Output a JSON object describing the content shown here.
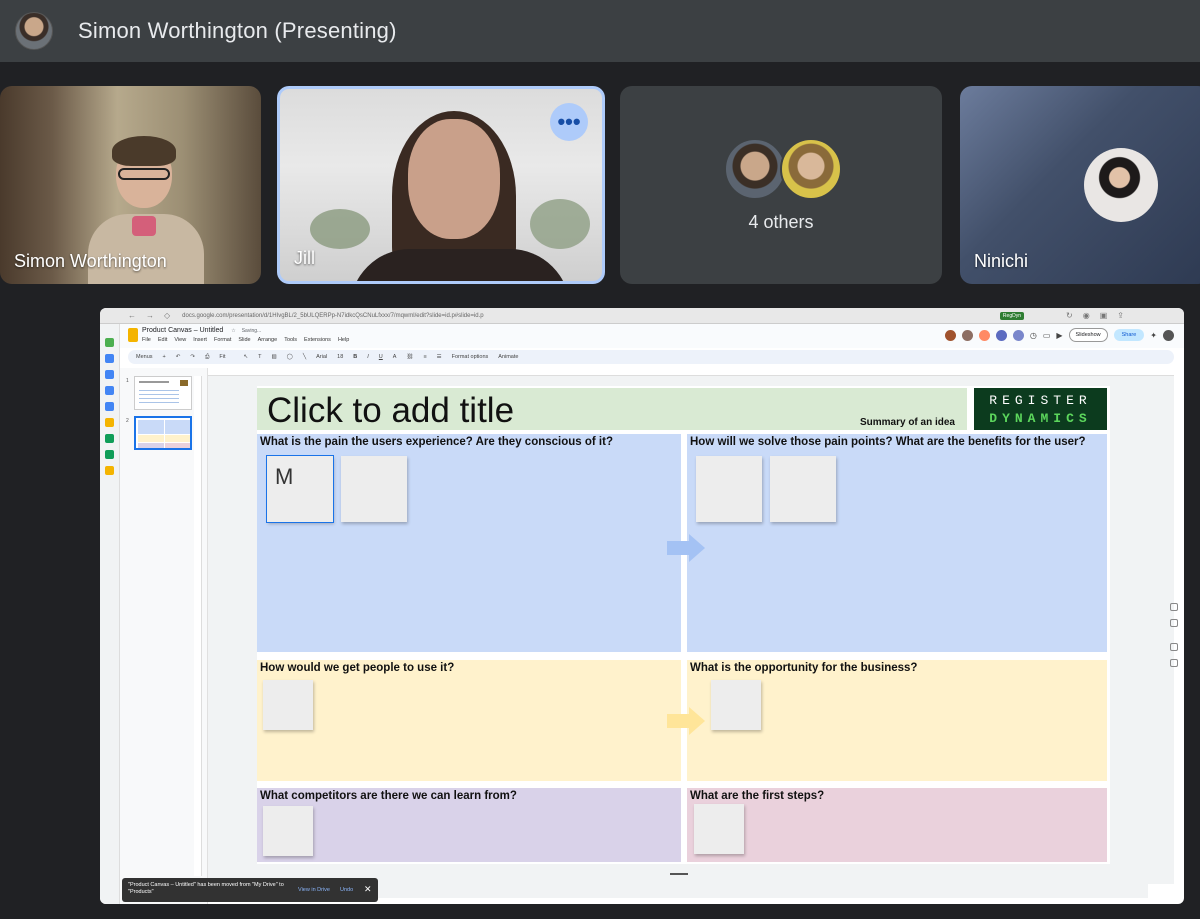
{
  "meeting": {
    "presenter_title": "Simon Worthington (Presenting)"
  },
  "tiles": {
    "simon": {
      "name": "Simon Worthington"
    },
    "jill": {
      "name": "Jill",
      "more_icon": "more-horiz-icon",
      "more_label": "•••"
    },
    "others": {
      "label": "4 others"
    },
    "ninichi": {
      "name": "Ninichi"
    }
  },
  "shared_screen": {
    "browser": {
      "url": "docs.google.com/presentation/d/1HIvgBL/2_5bULQERPp-N7idkcQsCNuLfxxx/7/mqwml/edit?slide=id.p#slide=id.p",
      "badge": "RegDyn"
    },
    "doc": {
      "title": "Product Canvas – Untitled",
      "saving": "Saving...",
      "menu": [
        "File",
        "Edit",
        "View",
        "Insert",
        "Format",
        "Slide",
        "Arrange",
        "Tools",
        "Extensions",
        "Help"
      ],
      "slideshow_label": "Slideshow",
      "share_label": "Share"
    },
    "toolbar": {
      "search": "Menus",
      "zoom": "Fit",
      "font": "Arial",
      "font_size": "18",
      "format_options": "Format options",
      "animate": "Animate"
    },
    "filmstrip": {
      "slide1": "1",
      "slide2": "2"
    },
    "slide": {
      "title_placeholder": "Click to add title",
      "subtitle": "Summary of an idea",
      "logo_line1": "REGISTER",
      "logo_line2": "DYNAMICS",
      "quadrants": {
        "pain": "What is the pain the users experience? Are they conscious of it?",
        "solve": "How will we solve those pain points? What are the benefits for the user?",
        "adoption": "How would we get people to use it?",
        "opportunity": "What is the opportunity for the business?",
        "competitors": "What competitors are there we can learn from?",
        "first_steps": "What are the first steps?"
      },
      "editing_sticky_text": "M"
    },
    "snackbar": {
      "message": "\"Product Canvas – Untitled\" has been moved from \"My Drive\" to \"Products\"",
      "view_label": "View in Drive",
      "undo_label": "Undo",
      "close_label": "✕"
    }
  },
  "colors": {
    "topbar": "#3c4043",
    "pain_bg": "#c9daf8",
    "adoption_bg": "#fff2cc",
    "competitors_bg": "#d9d2e9",
    "first_steps_bg": "#ead1dc",
    "title_bg": "#d9ead3",
    "logo_bg": "#0c3b1e",
    "logo_accent": "#5cd65c"
  }
}
